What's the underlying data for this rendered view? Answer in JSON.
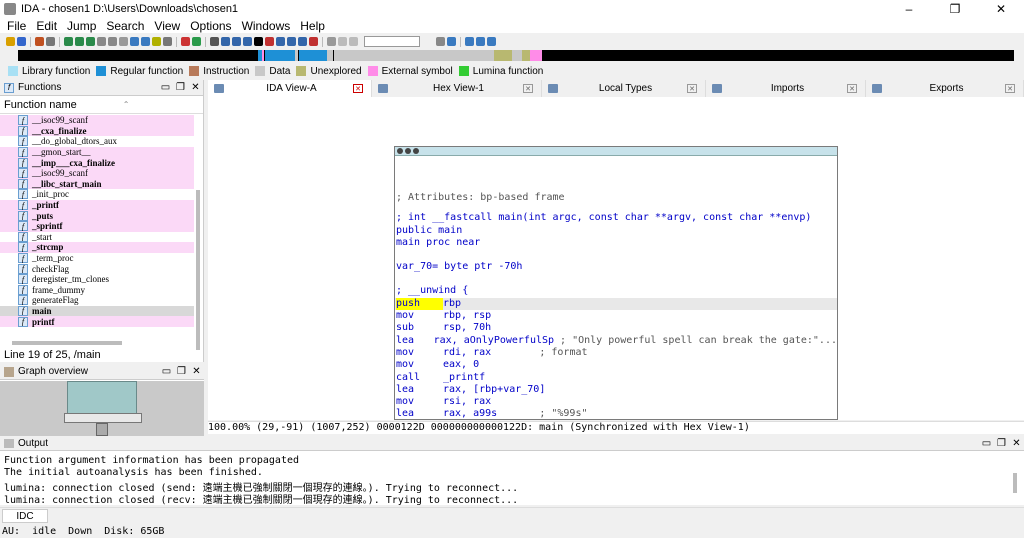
{
  "window": {
    "title": "IDA - chosen1 D:\\Users\\Downloads\\chosen1"
  },
  "menu": [
    "File",
    "Edit",
    "Jump",
    "Search",
    "View",
    "Options",
    "Windows",
    "Help"
  ],
  "legend": [
    {
      "label": "Library function",
      "color": "#a8e0f4"
    },
    {
      "label": "Regular function",
      "color": "#1e90d6"
    },
    {
      "label": "Instruction",
      "color": "#b87a5a"
    },
    {
      "label": "Data",
      "color": "#c8c8c8"
    },
    {
      "label": "Unexplored",
      "color": "#b8b870"
    },
    {
      "label": "External symbol",
      "color": "#ff8ce8"
    },
    {
      "label": "Lumina function",
      "color": "#33cc33"
    }
  ],
  "functions_panel": {
    "title": "Functions",
    "column_header": "Function name",
    "items": [
      {
        "name": "__isoc99_scanf",
        "lib": true,
        "bold": false
      },
      {
        "name": "__cxa_finalize",
        "lib": true,
        "bold": true
      },
      {
        "name": "__do_global_dtors_aux",
        "lib": false,
        "bold": false
      },
      {
        "name": "__gmon_start__",
        "lib": true,
        "bold": false
      },
      {
        "name": "__imp___cxa_finalize",
        "lib": true,
        "bold": true
      },
      {
        "name": "__isoc99_scanf",
        "lib": true,
        "bold": false
      },
      {
        "name": "__libc_start_main",
        "lib": true,
        "bold": true
      },
      {
        "name": "_init_proc",
        "lib": false,
        "bold": false
      },
      {
        "name": "_printf",
        "lib": true,
        "bold": true
      },
      {
        "name": "_puts",
        "lib": true,
        "bold": true
      },
      {
        "name": "_sprintf",
        "lib": true,
        "bold": true
      },
      {
        "name": "_start",
        "lib": false,
        "bold": false
      },
      {
        "name": "_strcmp",
        "lib": true,
        "bold": true
      },
      {
        "name": "_term_proc",
        "lib": false,
        "bold": false
      },
      {
        "name": "checkFlag",
        "lib": false,
        "bold": false
      },
      {
        "name": "deregister_tm_clones",
        "lib": false,
        "bold": false
      },
      {
        "name": "frame_dummy",
        "lib": false,
        "bold": false
      },
      {
        "name": "generateFlag",
        "lib": false,
        "bold": false
      },
      {
        "name": "main",
        "lib": false,
        "bold": true,
        "sel": true
      },
      {
        "name": "printf",
        "lib": true,
        "bold": true
      }
    ],
    "status": "Line 19 of 25, /main"
  },
  "graph_overview": {
    "title": "Graph overview"
  },
  "tabs": [
    {
      "label": "IDA View-A",
      "active": true
    },
    {
      "label": "Hex View-1",
      "active": false
    },
    {
      "label": "Local Types",
      "active": false
    },
    {
      "label": "Imports",
      "active": false
    },
    {
      "label": "Exports",
      "active": false
    }
  ],
  "code": {
    "comment1": "; Attributes: bp-based frame",
    "proto": "; int __fastcall main(int argc, const char **argv, const char **envp)",
    "public": "public main",
    "proc": "main proc near",
    "var": "var_70= byte ptr -70h",
    "unwind": "; __unwind {",
    "instructions": [
      {
        "m": "push",
        "o": "rbp",
        "c": ""
      },
      {
        "m": "mov",
        "o": "rbp, rsp",
        "c": ""
      },
      {
        "m": "sub",
        "o": "rsp, 70h",
        "c": ""
      },
      {
        "m": "lea",
        "o": "rax, aOnlyPowerfulSp",
        "c": " ; \"Only powerful spell can break the gate:\"..."
      },
      {
        "m": "mov",
        "o": "rdi, rax",
        "c": "        ; format"
      },
      {
        "m": "mov",
        "o": "eax, 0",
        "c": ""
      },
      {
        "m": "call",
        "o": "_printf",
        "c": ""
      },
      {
        "m": "lea",
        "o": "rax, [rbp+var_70]",
        "c": ""
      },
      {
        "m": "mov",
        "o": "rsi, rax",
        "c": ""
      },
      {
        "m": "lea",
        "o": "rax, a99s",
        "c": "       ; \"%99s\""
      }
    ]
  },
  "code_status": "100.00% (29,-91) (1007,252) 0000122D 000000000000122D: main (Synchronized with Hex View-1)",
  "output": {
    "title": "Output",
    "lines": [
      "Function argument information has been propagated",
      "The initial autoanalysis has been finished.",
      "lumina: connection closed (send: 遠端主機已強制關閉一個現存的連線。). Trying to reconnect...",
      "lumina: connection closed (recv: 遠端主機已強制關閉一個現存的連線。). Trying to reconnect..."
    ]
  },
  "idc_label": "IDC",
  "status": {
    "au": "AU:",
    "state": "idle",
    "dir": "Down",
    "disk": "Disk: 65GB"
  }
}
